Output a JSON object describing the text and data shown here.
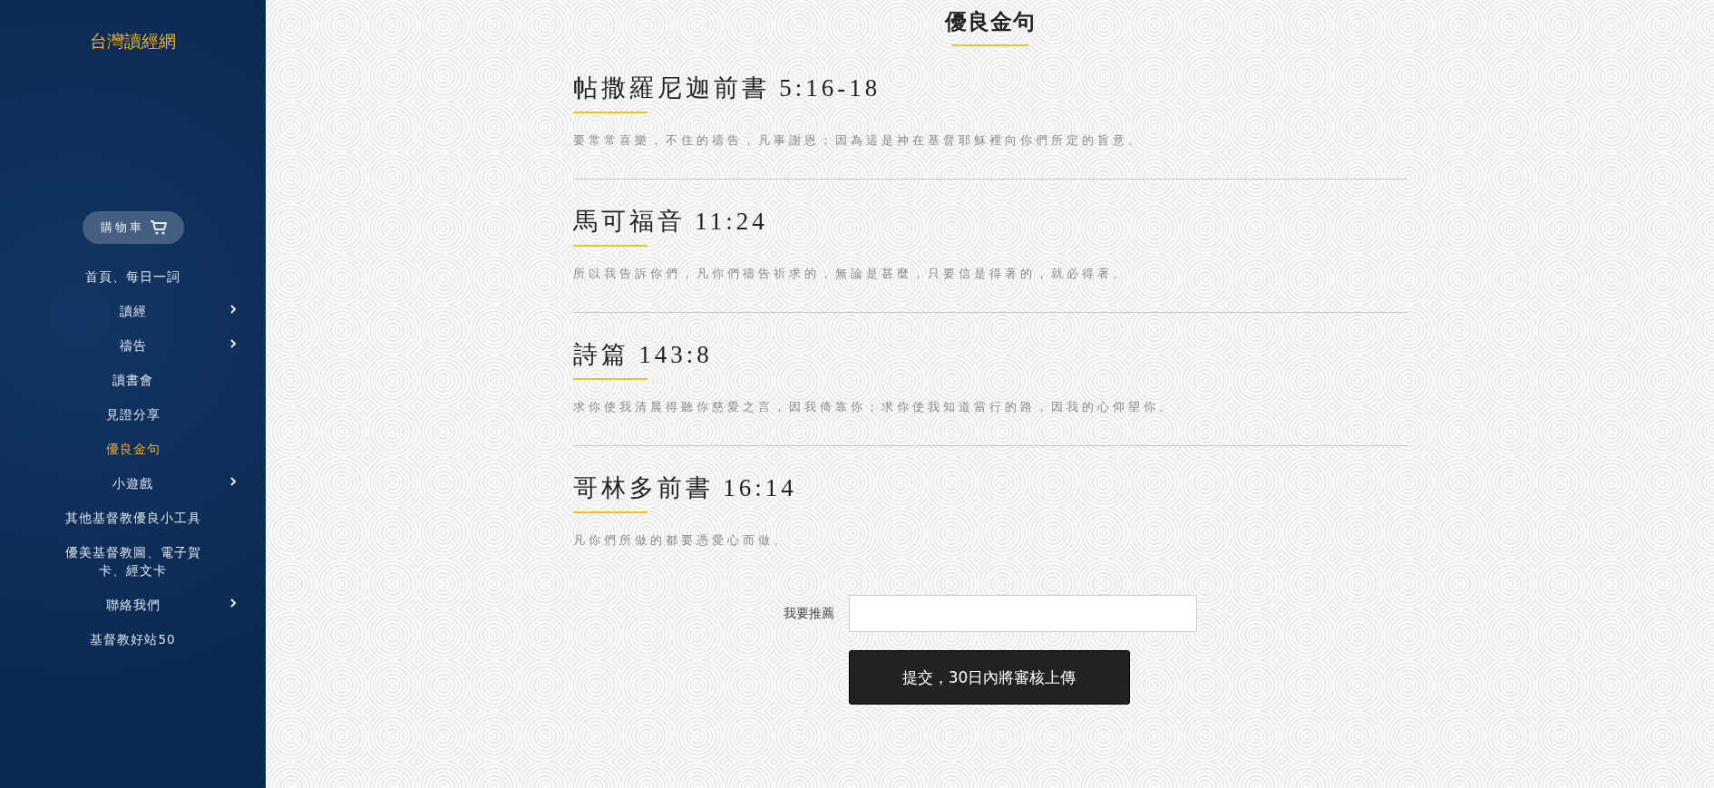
{
  "sidebar": {
    "logo": "台灣讀經網",
    "cart_button": "購物車",
    "items": [
      {
        "label": "首頁、每日一詞",
        "selected": false,
        "has_submenu": false
      },
      {
        "label": "讀經",
        "selected": false,
        "has_submenu": true
      },
      {
        "label": "禱告",
        "selected": false,
        "has_submenu": true
      },
      {
        "label": "讀書會",
        "selected": false,
        "has_submenu": false
      },
      {
        "label": "見證分享",
        "selected": false,
        "has_submenu": false
      },
      {
        "label": "優良金句",
        "selected": true,
        "has_submenu": false
      },
      {
        "label": "小遊戲",
        "selected": false,
        "has_submenu": true
      },
      {
        "label": "其他基督教優良小工具",
        "selected": false,
        "has_submenu": false
      },
      {
        "label": "優美基督教圖、電子賀卡、經文卡",
        "selected": false,
        "has_submenu": false
      },
      {
        "label": "聯絡我們",
        "selected": false,
        "has_submenu": true
      },
      {
        "label": "基督教好站50",
        "selected": false,
        "has_submenu": false
      }
    ]
  },
  "page_title": "優良金句",
  "verses": [
    {
      "reference": "帖撒羅尼迦前書 5:16-18",
      "text": "要常常喜樂，不住的禱告，凡事謝恩；因為這是神在基督耶穌裡向你們所定的旨意。"
    },
    {
      "reference": "馬可福音 11:24",
      "text": "所以我告訴你們，凡你們禱告祈求的，無論是甚麼，只要信是得著的，就必得著。"
    },
    {
      "reference": "詩篇 143:8",
      "text": "求你使我清晨得聽你慈愛之言，因我倚靠你；求你使我知道當行的路，因我的心仰望你。"
    },
    {
      "reference": "哥林多前書 16:14",
      "text": "凡你們所做的都要憑愛心而做。"
    }
  ],
  "form": {
    "label": "我要推薦",
    "submit_button": "提交，30日內將審核上傳"
  }
}
